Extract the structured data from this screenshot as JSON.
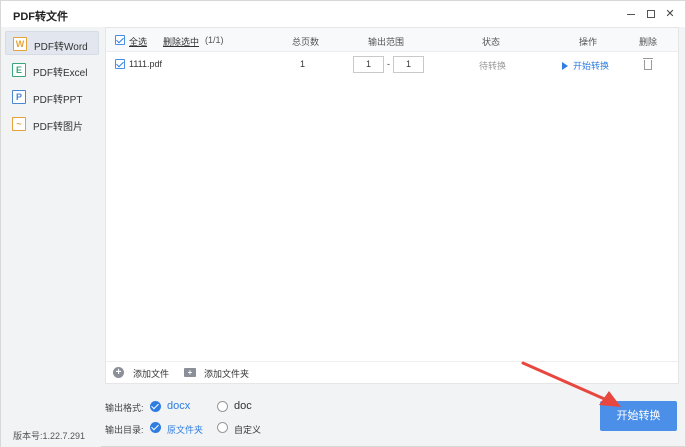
{
  "window": {
    "title": "PDF转文件"
  },
  "sidebar": {
    "items": [
      {
        "label": "PDF转Word",
        "icon_letter": "W",
        "icon": "word-icon",
        "active": true
      },
      {
        "label": "PDF转Excel",
        "icon_letter": "E",
        "icon": "excel-icon",
        "active": false
      },
      {
        "label": "PDF转PPT",
        "icon_letter": "P",
        "icon": "ppt-icon",
        "active": false
      },
      {
        "label": "PDF转图片",
        "icon_letter": "~",
        "icon": "image-icon",
        "active": false
      }
    ],
    "version": "版本号:1.22.7.291"
  },
  "table": {
    "header": {
      "select_all": "全选",
      "delete_selected": "删除选中",
      "count": "(1/1)",
      "total_pages": "总页数",
      "output_range": "输出范围",
      "status": "状态",
      "operation": "操作",
      "delete": "删除"
    },
    "rows": [
      {
        "checked": true,
        "filename": "1111.pdf",
        "pages": "1",
        "range_from": "1",
        "range_sep": "-",
        "range_to": "1",
        "status": "待转换",
        "action": "开始转换"
      }
    ]
  },
  "addbar": {
    "add_file": "添加文件",
    "add_folder": "添加文件夹"
  },
  "options": {
    "format_label": "输出格式:",
    "format_options": [
      "docx",
      "doc"
    ],
    "format_selected": "docx",
    "dir_label": "输出目录:",
    "dir_options": [
      "原文件夹",
      "自定义"
    ],
    "dir_selected": "原文件夹"
  },
  "start_button": "开始转换",
  "colors": {
    "accent": "#2f7de1",
    "button": "#4b8fe8",
    "arrow": "#e8473f"
  }
}
